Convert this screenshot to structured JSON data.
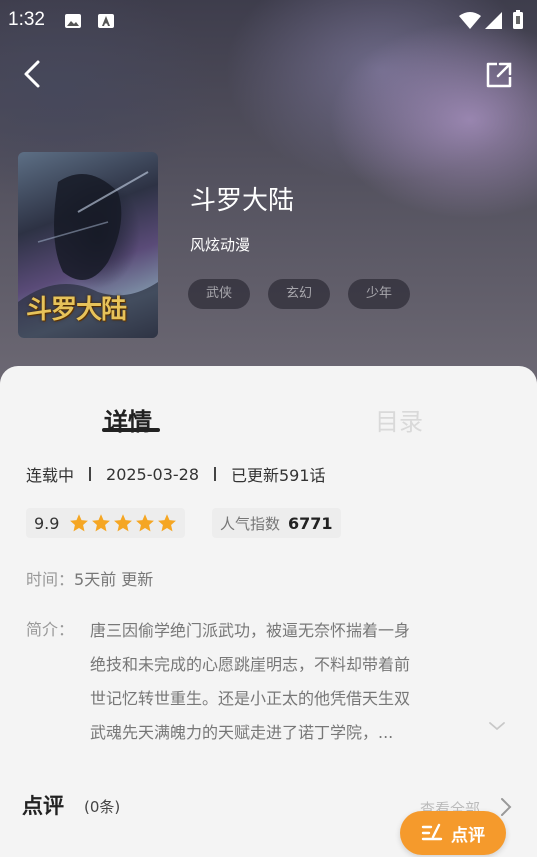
{
  "status_bar": {
    "time": "1:32"
  },
  "comic": {
    "title": "斗罗大陆",
    "author": "风炫动漫",
    "cover_text": "斗罗大陆",
    "tags": [
      "武侠",
      "玄幻",
      "少年"
    ]
  },
  "tabs": {
    "detail": "详情",
    "contents": "目录"
  },
  "meta": {
    "status": "连载中",
    "date": "2025-03-28",
    "updated": "已更新591话"
  },
  "rating": {
    "score": "9.9",
    "stars": 5,
    "popularity_label": "人气指数",
    "popularity_value": "6771"
  },
  "time_info": {
    "label": "时间：",
    "value": "5天前 更新"
  },
  "intro": {
    "label": "简介：",
    "lines": [
      "唐三因偷学绝门派武功，被逼无奈怀揣着一身",
      "绝技和未完成的心愿跳崖明志，不料却带着前",
      "世记忆转世重生。还是小正太的他凭借天生双",
      "武魂先天满魄力的天赋走进了诺丁学院，..."
    ]
  },
  "review": {
    "title": "点评",
    "count": "(0条)",
    "view_all": "查看全部",
    "button_label": "点评"
  },
  "colors": {
    "accent": "#f59a2c",
    "star": "#f5a623"
  }
}
